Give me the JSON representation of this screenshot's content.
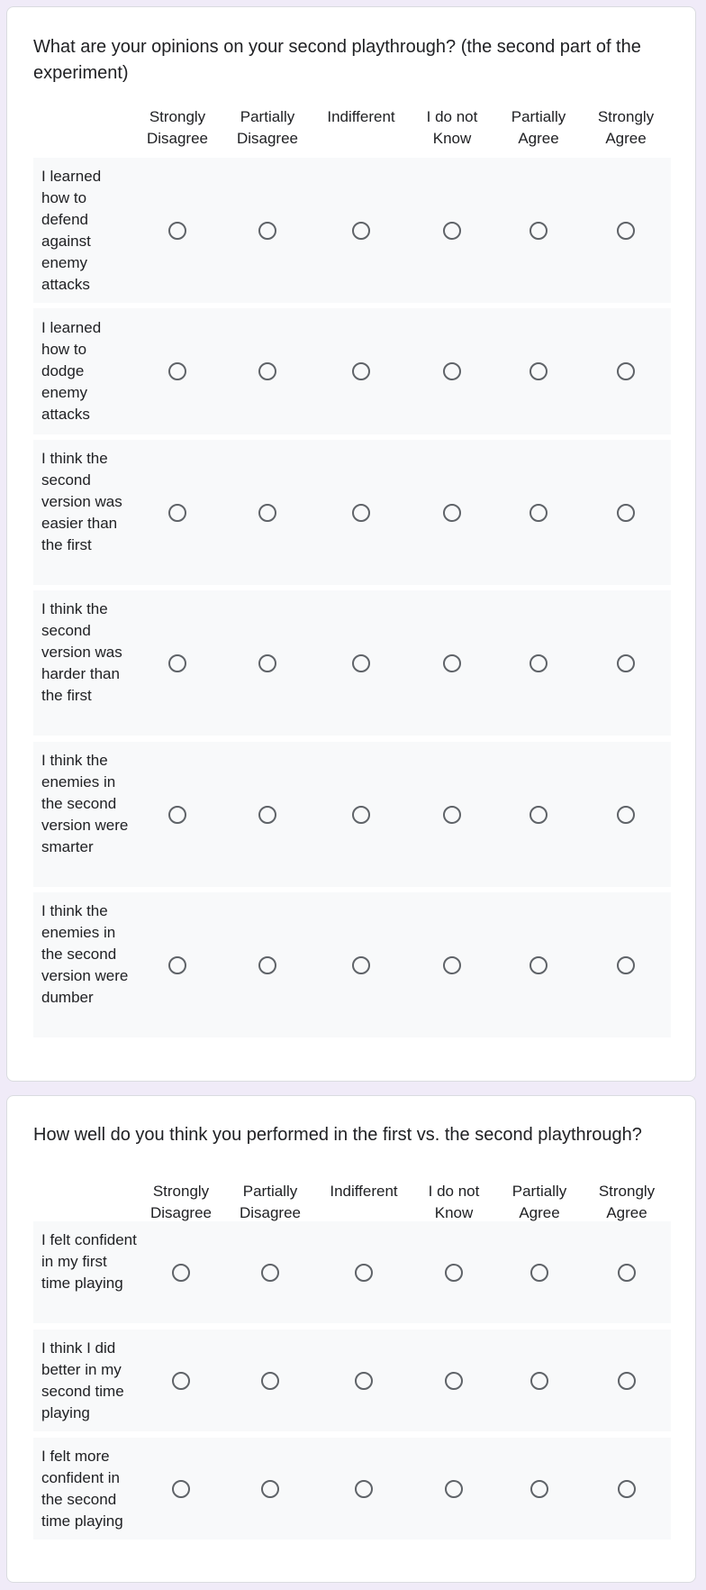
{
  "questions": [
    {
      "title": "What are your opinions on your second playthrough? (the second part of the experiment)",
      "columns": [
        "Strongly Disagree",
        "Partially Disagree",
        "Indifferent",
        "I do not Know",
        "Partially Agree",
        "Strongly Agree"
      ],
      "rows": [
        "I learned how to defend against enemy attacks",
        "I learned how to dodge enemy attacks",
        "I think the second version was easier than the first",
        "I think the second version was harder than the first",
        "I think the enemies in the second version were smarter",
        "I think the enemies in the second version were dumber"
      ]
    },
    {
      "title": "How well do you think you performed in the first vs. the second playthrough?",
      "columns": [
        "Strongly Disagree",
        "Partially Disagree",
        "Indifferent",
        "I do not Know",
        "Partially Agree",
        "Strongly Agree"
      ],
      "rows": [
        "I felt confident in my first time playing",
        "I think I did better in my second time playing",
        "I felt more confident in the second time playing"
      ]
    }
  ],
  "colors": {
    "page_background": "#f0ebf8",
    "card_background": "#ffffff",
    "row_background": "#f8f9fa",
    "radio_border": "#5f6368",
    "text": "#202124"
  },
  "icons": {
    "radio": "radio-button-unchecked-icon"
  }
}
